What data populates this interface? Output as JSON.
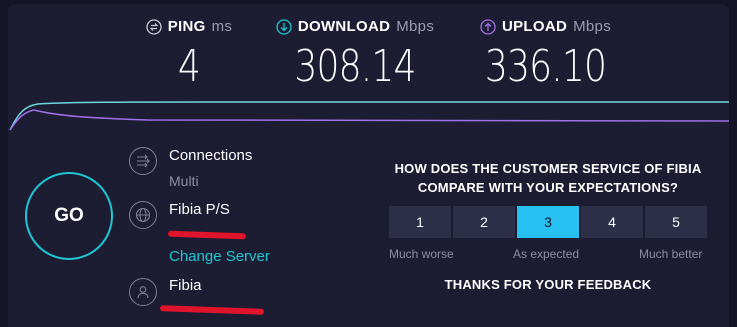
{
  "metrics": {
    "ping": {
      "label": "PING",
      "unit": "ms",
      "value": "4",
      "icon": "ping-icon"
    },
    "download": {
      "label": "DOWNLOAD",
      "unit": "Mbps",
      "value": "308.14",
      "icon": "download-icon"
    },
    "upload": {
      "label": "UPLOAD",
      "unit": "Mbps",
      "value": "336.10",
      "icon": "upload-icon"
    }
  },
  "go_label": "GO",
  "connections": {
    "title": "Connections",
    "value": "Multi"
  },
  "server": {
    "name": "Fibia P/S",
    "change_label": "Change Server"
  },
  "provider": {
    "name": "Fibia"
  },
  "survey": {
    "question": "HOW DOES THE CUSTOMER SERVICE OF FIBIA COMPARE WITH YOUR EXPECTATIONS?",
    "options": [
      "1",
      "2",
      "3",
      "4",
      "5"
    ],
    "selected": "3",
    "low_label": "Much worse",
    "mid_label": "As expected",
    "high_label": "Much better",
    "thanks": "THANKS FOR YOUR FEEDBACK"
  },
  "colors": {
    "accent": "#1fc7d4",
    "download_line": "#6fd6e0",
    "upload_line": "#a070e8",
    "selected_option": "#26c1f0",
    "redaction": "#e0142a"
  }
}
